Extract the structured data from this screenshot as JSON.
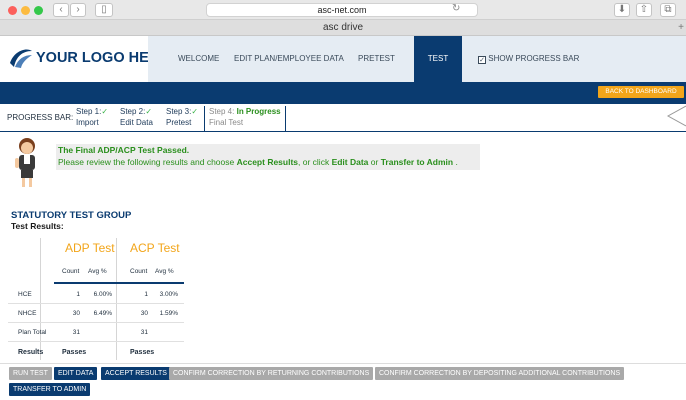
{
  "browser": {
    "url": "asc-net.com",
    "tab_title": "asc drive"
  },
  "logo": {
    "text": "YOUR LOGO HERE"
  },
  "nav": {
    "items": [
      "WELCOME",
      "EDIT PLAN/EMPLOYEE DATA",
      "PRETEST",
      "TEST"
    ],
    "show_progress": "SHOW PROGRESS BAR"
  },
  "back_button": "BACK TO DASHBOARD",
  "progress": {
    "label": "PROGRESS BAR:",
    "steps": [
      {
        "title": "Step 1:",
        "sub": "Import"
      },
      {
        "title": "Step 2:",
        "sub": "Edit Data"
      },
      {
        "title": "Step 3:",
        "sub": "Pretest"
      },
      {
        "title": "Step 4:",
        "status": "In Progress",
        "sub": "Final Test"
      }
    ]
  },
  "message": {
    "line1": "The Final ADP/ACP Test Passed.",
    "line2_prefix": "Please review the following results and choose ",
    "accept": "Accept Results",
    "mid1": ", or click ",
    "edit": "Edit Data",
    "mid2": " or ",
    "transfer": "Transfer to Admin",
    "end": " ."
  },
  "group": {
    "title": "STATUTORY TEST GROUP",
    "subtitle": "Test Results:"
  },
  "table": {
    "adp_title": "ADP Test",
    "acp_title": "ACP Test",
    "col_count": "Count",
    "col_avg": "Avg %",
    "rows": [
      {
        "label": "HCE",
        "adp_count": "1",
        "adp_avg": "6.00%",
        "acp_count": "1",
        "acp_avg": "3.00%"
      },
      {
        "label": "NHCE",
        "adp_count": "30",
        "adp_avg": "6.49%",
        "acp_count": "30",
        "acp_avg": "1.59%"
      },
      {
        "label": "Plan Total",
        "adp_count": "31",
        "adp_avg": "",
        "acp_count": "31",
        "acp_avg": ""
      }
    ],
    "results_label": "Results",
    "adp_result": "Passes",
    "acp_result": "Passes"
  },
  "footer": {
    "buttons": [
      "RUN TEST",
      "EDIT DATA",
      "ACCEPT RESULTS",
      "CONFIRM CORRECTION BY RETURNING CONTRIBUTIONS",
      "CONFIRM CORRECTION BY DEPOSITING ADDITIONAL CONTRIBUTIONS",
      "TRANSFER TO ADMIN"
    ]
  }
}
